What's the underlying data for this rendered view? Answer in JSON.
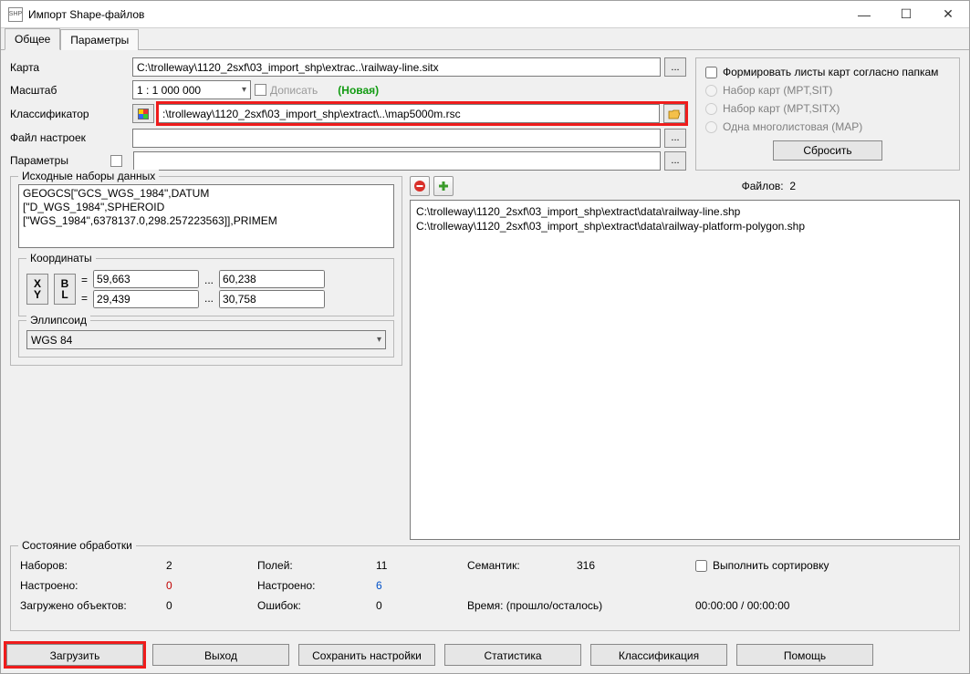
{
  "window": {
    "title": "Импорт Shape-файлов",
    "app_icon_text": "SHP"
  },
  "tabs": {
    "general": "Общее",
    "params": "Параметры"
  },
  "left": {
    "map_label": "Карта",
    "map_value": "C:\\trolleway\\1120_2sxf\\03_import_shp\\extrac..\\railway-line.sitx",
    "scale_label": "Масштаб",
    "scale_value": "1 : 1 000 000",
    "append_label": "Дописать",
    "new_label": "(Новая)",
    "classifier_label": "Классификатор",
    "classifier_value": ":\\trolleway\\1120_2sxf\\03_import_shp\\extract\\..\\map5000m.rsc",
    "settings_label": "Файл настроек",
    "settings_value": "",
    "params_label": "Параметры",
    "params_value": "",
    "dots": "..."
  },
  "right": {
    "form_sheets": "Формировать листы карт согласно папкам",
    "radio1": "Набор карт (MPT,SIT)",
    "radio2": "Набор карт (MPT,SITX)",
    "radio3": "Одна многолистовая (MAP)",
    "reset": "Сбросить"
  },
  "src": {
    "legend": "Исходные наборы данных",
    "text": "GEOGCS[\"GCS_WGS_1984\",DATUM\n[\"D_WGS_1984\",SPHEROID\n[\"WGS_1984\",6378137.0,298.257223563]],PRIMEM",
    "coords_legend": "Координаты",
    "xy": "X\nY",
    "bl": "B\nL",
    "eq": "=",
    "x1": "59,663",
    "x2": "60,238",
    "y1": "29,439",
    "y2": "30,758",
    "ellipsoid_legend": "Эллипсоид",
    "ellipsoid_value": "WGS 84",
    "dots": "..."
  },
  "files": {
    "count_label": "Файлов:",
    "count_value": "2",
    "items": [
      "C:\\trolleway\\1120_2sxf\\03_import_shp\\extract\\data\\railway-line.shp",
      "C:\\trolleway\\1120_2sxf\\03_import_shp\\extract\\data\\railway-platform-polygon.shp"
    ]
  },
  "status": {
    "legend": "Состояние обработки",
    "sets_label": "Наборов:",
    "sets_value": "2",
    "fields_label": "Полей:",
    "fields_value": "11",
    "sem_label": "Семантик:",
    "sem_value": "316",
    "sort_label": "Выполнить сортировку",
    "tuned_label": "Настроено:",
    "tuned_value": "0",
    "tuned2_label": "Настроено:",
    "tuned2_value": "6",
    "loaded_label": "Загружено объектов:",
    "loaded_value": "0",
    "errors_label": "Ошибок:",
    "errors_value": "0",
    "time_label": "Время: (прошло/осталось)",
    "time_value": "00:00:00 / 00:00:00"
  },
  "bottom": {
    "load": "Загрузить",
    "exit": "Выход",
    "save": "Сохранить настройки",
    "stats": "Статистика",
    "classify": "Классификация",
    "help": "Помощь"
  }
}
